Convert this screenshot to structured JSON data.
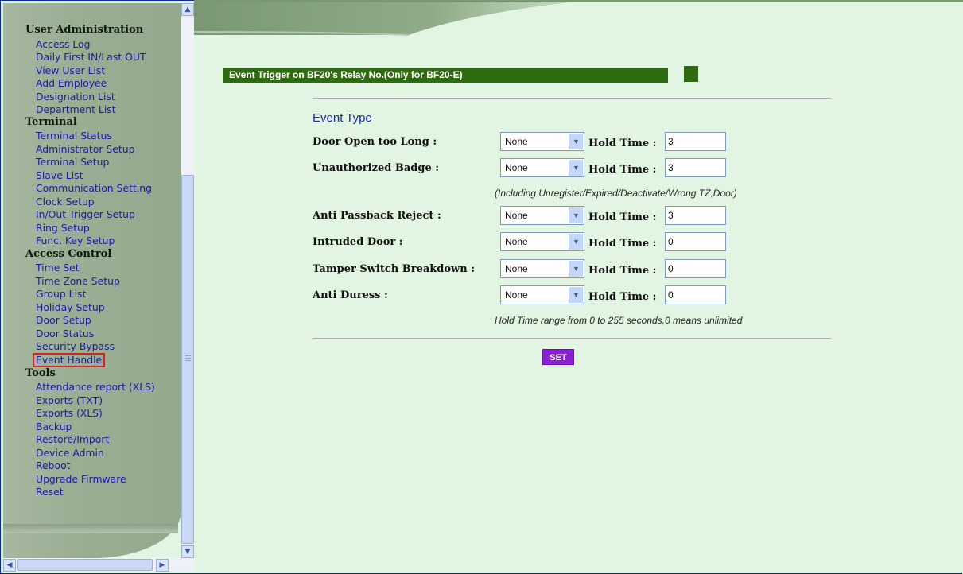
{
  "sidebar": {
    "sections": [
      {
        "title": "User Administration",
        "items": [
          "Access Log",
          "Daily First IN/Last OUT",
          "View User List",
          "Add Employee",
          "Designation List",
          "Department List"
        ]
      },
      {
        "title": "Terminal",
        "items": [
          "Terminal Status",
          "Administrator Setup",
          "Terminal Setup",
          "Slave List",
          "Communication Setting",
          "Clock Setup",
          "In/Out Trigger Setup",
          "Ring Setup",
          "Func. Key Setup"
        ]
      },
      {
        "title": "Access Control",
        "items": [
          "Time Set",
          "Time Zone Setup",
          "Group List",
          "Holiday Setup",
          "Door Setup",
          "Door Status",
          "Security Bypass",
          "Event Handle"
        ]
      },
      {
        "title": "Tools",
        "items": [
          "Attendance report (XLS)",
          "Exports (TXT)",
          "Exports (XLS)",
          "Backup",
          "Restore/Import",
          "Device Admin",
          "Reboot",
          "Upgrade Firmware",
          "Reset"
        ]
      }
    ],
    "highlighted_item": "Event Handle"
  },
  "main": {
    "title": "Event Trigger on BF20's Relay No.(Only for BF20-E)",
    "event_type_heading": "Event Type",
    "hold_time_label": "Hold Time :",
    "rows": [
      {
        "label": "Door Open too Long :",
        "select": "None",
        "hold_time": "3"
      },
      {
        "label": "Unauthorized Badge :",
        "select": "None",
        "hold_time": "3"
      },
      {
        "label": "Anti Passback Reject :",
        "select": "None",
        "hold_time": "3"
      },
      {
        "label": "Intruded Door :",
        "select": "None",
        "hold_time": "0"
      },
      {
        "label": "Tamper Switch Breakdown :",
        "select": "None",
        "hold_time": "0"
      },
      {
        "label": "Anti Duress :",
        "select": "None",
        "hold_time": "0"
      }
    ],
    "unauthorized_note": "(Including Unregister/Expired/Deactivate/Wrong TZ,Door)",
    "hold_time_note": "Hold Time range from 0 to 255 seconds,0 means unlimited",
    "set_button": "SET"
  },
  "colors": {
    "title_bar": "#2f6b0f",
    "set_button": "#8a1fd6",
    "link": "#1a1aa8",
    "background": "#e2f5e2",
    "highlight": "#e02020"
  }
}
